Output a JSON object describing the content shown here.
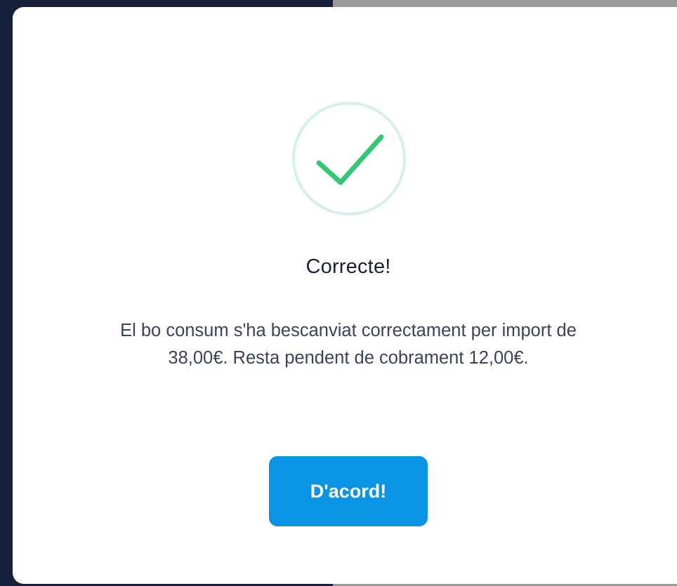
{
  "dialog": {
    "status_icon": "check-circle-icon",
    "title": "Correcte!",
    "message": "El bo consum s'ha bescanviat correctament per import de 38,00€. Resta pendent de cobrament 12,00€.",
    "confirm_label": "D'acord!"
  },
  "colors": {
    "success_ring": "#d3f2df",
    "success_check": "#34c774",
    "button_background": "#0a95e4",
    "title_text": "#1a2238",
    "body_text": "#3b4359"
  }
}
